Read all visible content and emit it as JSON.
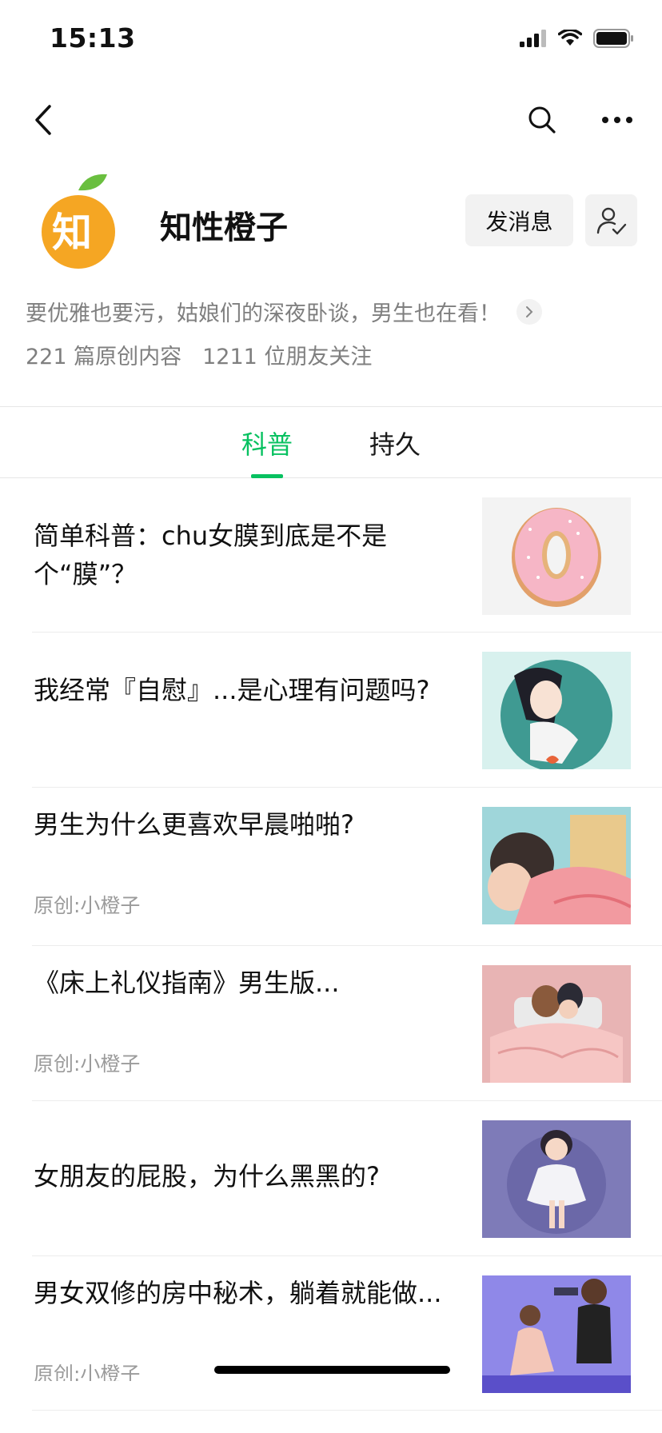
{
  "status_bar": {
    "time": "15:13"
  },
  "account": {
    "name": "知性橙子",
    "avatar_char": "知",
    "message_button": "发消息",
    "description": "要优雅也要污，姑娘们的深夜卧谈，男生也在看！",
    "original_count": "221 篇原创内容",
    "followers": "1211 位朋友关注"
  },
  "tabs": [
    {
      "label": "科普",
      "active": true
    },
    {
      "label": "持久",
      "active": false
    }
  ],
  "articles": [
    {
      "title": "简单科普：chu女膜到底是不是个“膜”？",
      "source": ""
    },
    {
      "title": "我经常『自慰』...是心理有问题吗?",
      "source": ""
    },
    {
      "title": "男生为什么更喜欢早晨啪啪?",
      "source": "原创:小橙子"
    },
    {
      "title": "《床上礼仪指南》男生版...",
      "source": "原创:小橙子"
    },
    {
      "title": "女朋友的屁股，为什么黑黑的?",
      "source": ""
    },
    {
      "title": "男女双修的房中秘术，躺着就能做...",
      "source": "原创:小橙子"
    }
  ],
  "colors": {
    "accent": "#07c160",
    "avatar_orange": "#f5a623",
    "leaf_green": "#6abf3f"
  }
}
